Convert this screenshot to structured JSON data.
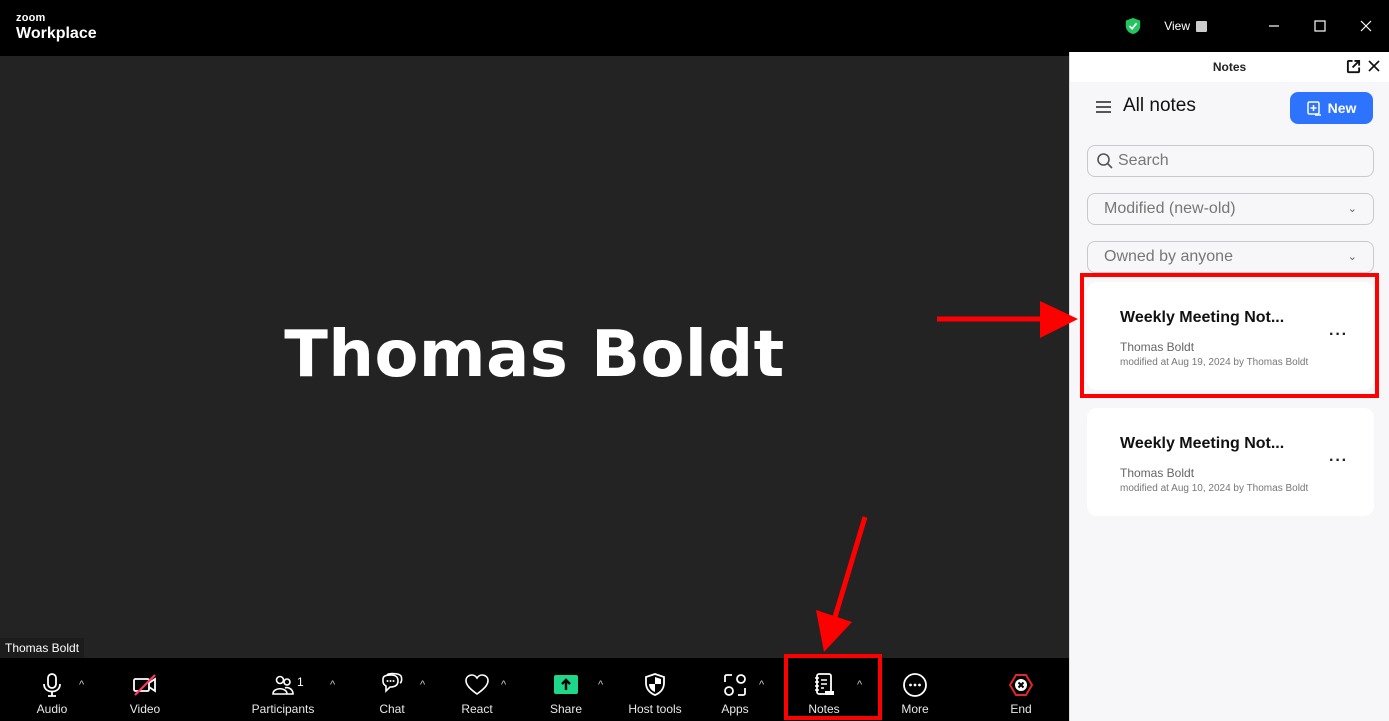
{
  "app": {
    "brand_small": "zoom",
    "brand_big": "Workplace"
  },
  "titlebar": {
    "view_label": "View"
  },
  "meeting": {
    "participant_display_name": "Thomas Boldt",
    "name_tag": "Thomas Boldt"
  },
  "toolbar": {
    "audio": "Audio",
    "video": "Video",
    "participants": "Participants",
    "participants_count": "1",
    "chat": "Chat",
    "react": "React",
    "share": "Share",
    "host_tools": "Host tools",
    "apps": "Apps",
    "notes": "Notes",
    "more": "More",
    "end": "End",
    "share_color": "#1dd88a",
    "end_color": "#e02828"
  },
  "notes_panel": {
    "title": "Notes",
    "heading": "All notes",
    "new_label": "New",
    "search_placeholder": "Search",
    "sort_value": "Modified (new-old)",
    "owner_value": "Owned by anyone",
    "accent_color": "#0b5cff",
    "notes": [
      {
        "title": "Weekly Meeting Not...",
        "author": "Thomas Boldt",
        "modified": "modified at Aug 19, 2024 by Thomas Boldt"
      },
      {
        "title": "Weekly Meeting Not...",
        "author": "Thomas Boldt",
        "modified": "modified at Aug 10, 2024 by Thomas Boldt"
      }
    ]
  },
  "annotations": {
    "color": "#ff0000"
  }
}
